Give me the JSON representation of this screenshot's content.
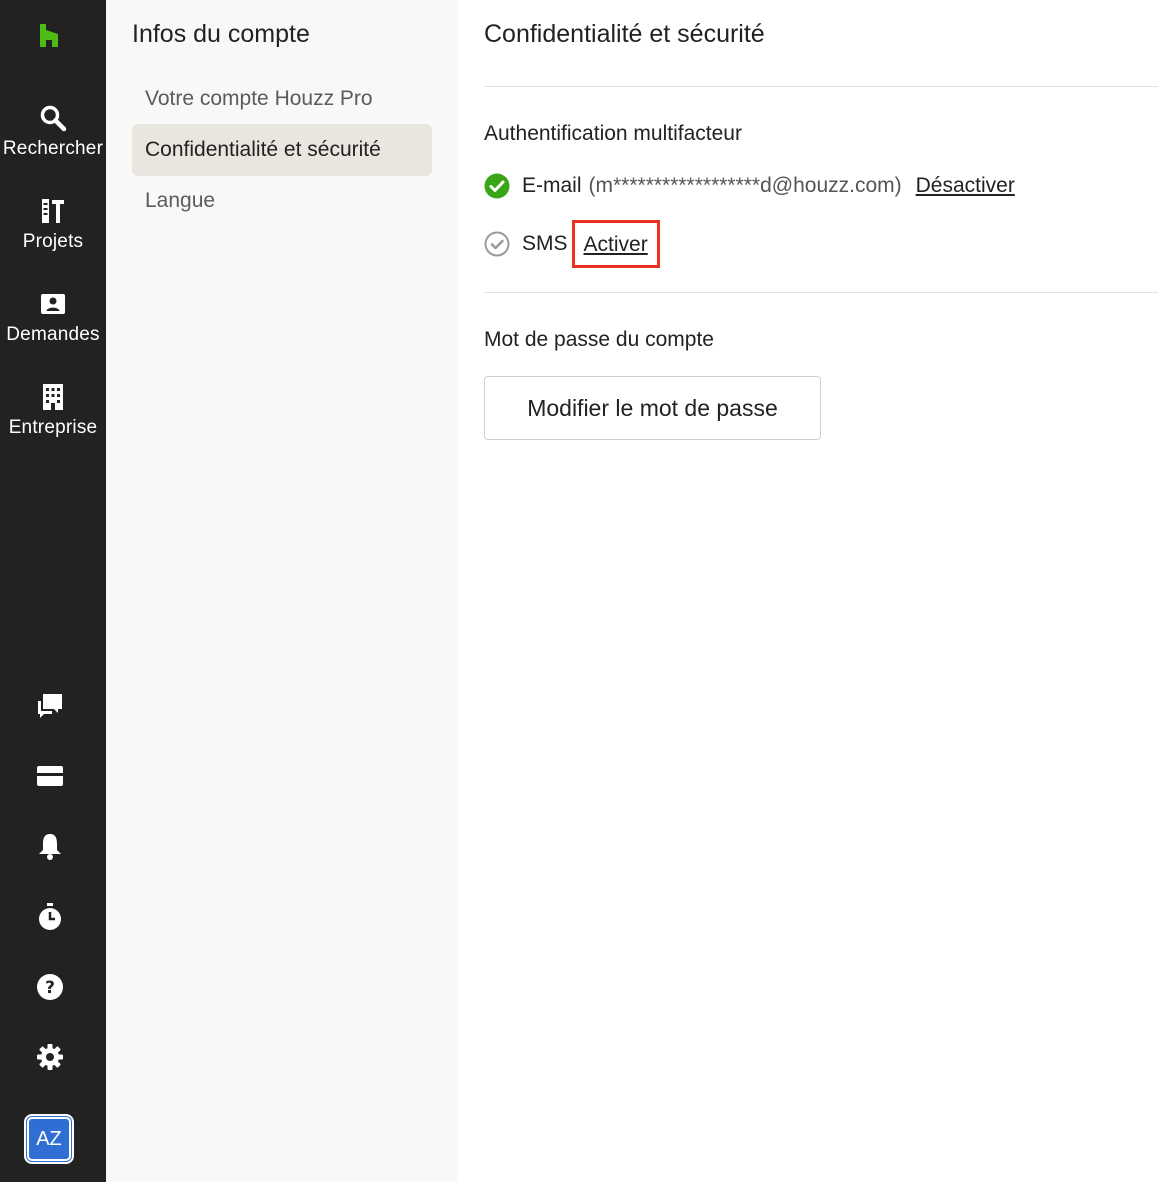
{
  "rail": {
    "nav": [
      {
        "label": "Rechercher",
        "icon": "search-icon"
      },
      {
        "label": "Projets",
        "icon": "projects-icon"
      },
      {
        "label": "Demandes",
        "icon": "requests-icon"
      },
      {
        "label": "Entreprise",
        "icon": "building-icon"
      }
    ],
    "bottom_icons": [
      "chat-icon",
      "inbox-icon",
      "bell-icon",
      "stopwatch-icon",
      "help-icon",
      "gear-icon"
    ],
    "avatar_initials": "AZ",
    "brand_color": "#4dbc15"
  },
  "subnav": {
    "title": "Infos du compte",
    "items": [
      {
        "label": "Votre compte Houzz Pro",
        "active": false
      },
      {
        "label": "Confidentialité et sécurité",
        "active": true
      },
      {
        "label": "Langue",
        "active": false
      }
    ]
  },
  "main": {
    "title": "Confidentialité et sécurité",
    "mfa": {
      "title": "Authentification multifacteur",
      "email": {
        "name": "E-mail",
        "value": "(m******************d@houzz.com)",
        "action": "Désactiver",
        "enabled": true
      },
      "sms": {
        "name": "SMS",
        "action": "Activer",
        "enabled": false
      }
    },
    "password": {
      "title": "Mot de passe du compte",
      "button": "Modifier le mot de passe"
    }
  }
}
